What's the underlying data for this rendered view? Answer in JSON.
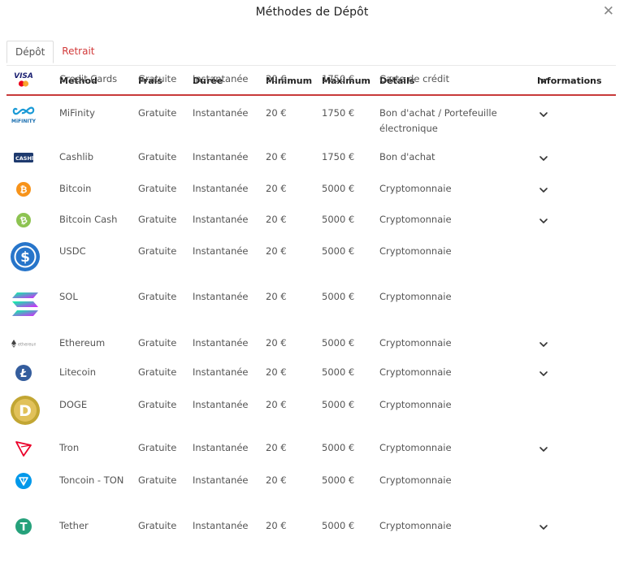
{
  "title": "Méthodes de Dépôt",
  "close_icon_char": "✕",
  "tabs": [
    {
      "label": "Dépôt",
      "active": true
    },
    {
      "label": "Retrait",
      "active": false
    }
  ],
  "headers": {
    "method": "Method",
    "fees": "Frais",
    "duration": "Durée",
    "minimum": "Minimum",
    "maximum": "Maximum",
    "details": "Détails",
    "info": "Informations"
  },
  "rows": [
    {
      "icon": "visa-mastercard-logo",
      "method": "Credit Cards",
      "fees": "Gratuite",
      "duration": "Instantanée",
      "min": "20 €",
      "max": "1750 €",
      "details": "Carte de crédit",
      "has_info": true
    },
    {
      "icon": "mifinity-logo",
      "method": "MiFinity",
      "fees": "Gratuite",
      "duration": "Instantanée",
      "min": "20 €",
      "max": "1750 €",
      "details": "Bon d'achat / Portefeuille électronique",
      "has_info": true
    },
    {
      "icon": "cashlib-logo",
      "method": "Cashlib",
      "fees": "Gratuite",
      "duration": "Instantanée",
      "min": "20 €",
      "max": "1750 €",
      "details": "Bon d'achat",
      "has_info": true
    },
    {
      "icon": "bitcoin-logo",
      "method": "Bitcoin",
      "fees": "Gratuite",
      "duration": "Instantanée",
      "min": "20 €",
      "max": "5000 €",
      "details": "Cryptomonnaie",
      "has_info": true
    },
    {
      "icon": "bitcoin-cash-logo",
      "method": "Bitcoin Cash",
      "fees": "Gratuite",
      "duration": "Instantanée",
      "min": "20 €",
      "max": "5000 €",
      "details": "Cryptomonnaie",
      "has_info": true
    },
    {
      "icon": "usdc-logo",
      "method": "USDC",
      "fees": "Gratuite",
      "duration": "Instantanée",
      "min": "20 €",
      "max": "5000 €",
      "details": "Cryptomonnaie",
      "has_info": false
    },
    {
      "icon": "solana-logo",
      "method": "SOL",
      "fees": "Gratuite",
      "duration": "Instantanée",
      "min": "20 €",
      "max": "5000 €",
      "details": "Cryptomonnaie",
      "has_info": false
    },
    {
      "icon": "ethereum-logo",
      "method": "Ethereum",
      "fees": "Gratuite",
      "duration": "Instantanée",
      "min": "20 €",
      "max": "5000 €",
      "details": "Cryptomonnaie",
      "has_info": true
    },
    {
      "icon": "litecoin-logo",
      "method": "Litecoin",
      "fees": "Gratuite",
      "duration": "Instantanée",
      "min": "20 €",
      "max": "5000 €",
      "details": "Cryptomonnaie",
      "has_info": true
    },
    {
      "icon": "dogecoin-logo",
      "method": "DOGE",
      "fees": "Gratuite",
      "duration": "Instantanée",
      "min": "20 €",
      "max": "5000 €",
      "details": "Cryptomonnaie",
      "has_info": false
    },
    {
      "icon": "tron-logo",
      "method": "Tron",
      "fees": "Gratuite",
      "duration": "Instantanée",
      "min": "20 €",
      "max": "5000 €",
      "details": "Cryptomonnaie",
      "has_info": true
    },
    {
      "icon": "toncoin-logo",
      "method": "Toncoin - TON",
      "fees": "Gratuite",
      "duration": "Instantanée",
      "min": "20 €",
      "max": "5000 €",
      "details": "Cryptomonnaie",
      "has_info": false
    },
    {
      "icon": "tether-logo",
      "method": "Tether",
      "fees": "Gratuite",
      "duration": "Instantanée",
      "min": "20 €",
      "max": "5000 €",
      "details": "Cryptomonnaie",
      "has_info": true
    }
  ],
  "logo_texts": {
    "visa": "VISA",
    "mifinity": "MiFINITY",
    "cashlib": "CASHlib",
    "ethereum": "ethereum"
  },
  "colors": {
    "accent": "#c83a3a",
    "bitcoin": "#f7931a",
    "bitcoin_cash": "#8dc351",
    "usdc": "#2775ca",
    "litecoin": "#345d9d",
    "dogecoin": "#c2a633",
    "tron": "#eb0029",
    "toncoin": "#0098ea",
    "tether": "#26a17b"
  }
}
